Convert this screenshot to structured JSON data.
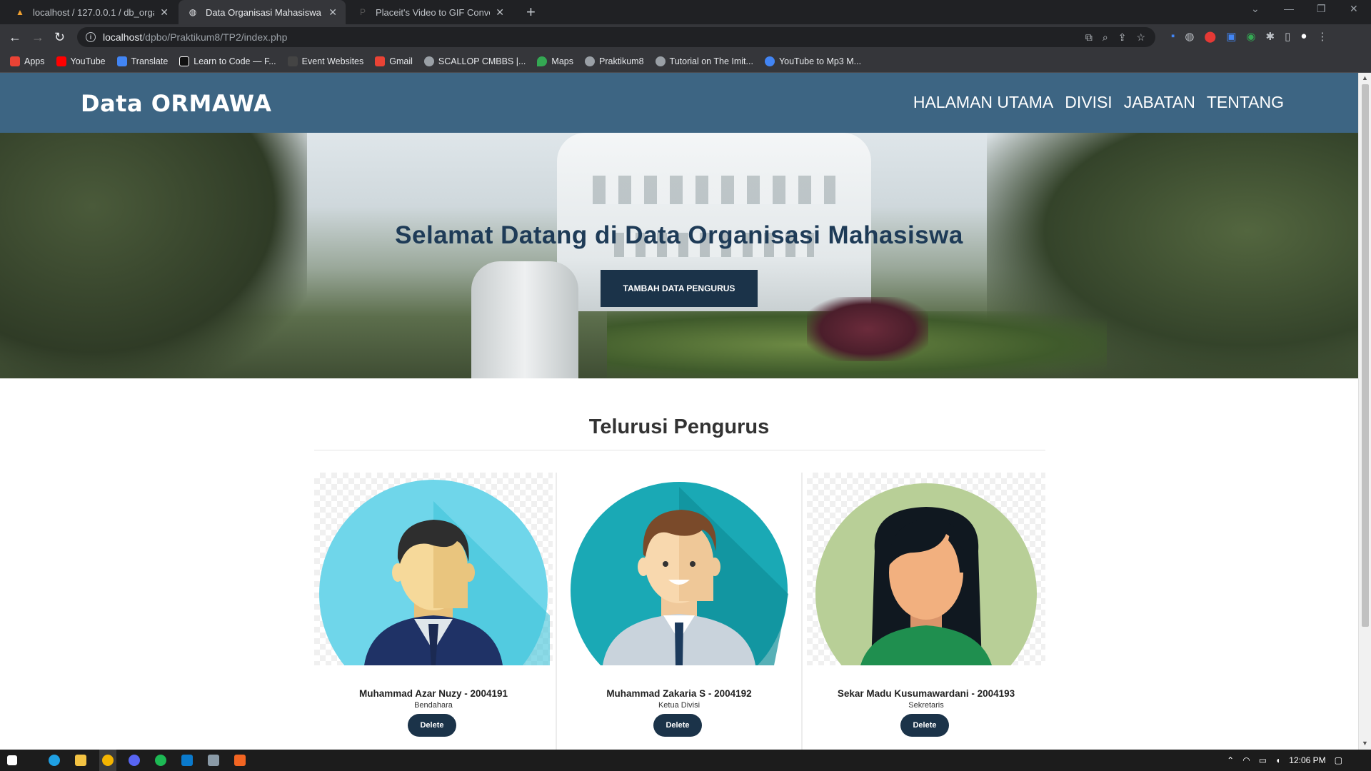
{
  "browser": {
    "tabs": [
      {
        "title": "localhost / 127.0.0.1 / db_organis",
        "active": false
      },
      {
        "title": "Data Organisasi Mahasiswa",
        "active": true
      },
      {
        "title": "Placeit's Video to GIF Converter",
        "active": false
      }
    ],
    "url_host": "localhost",
    "url_path": "/dpbo/Praktikum8/TP2/index.php",
    "bookmarks": [
      {
        "label": "Apps",
        "color": "#ea4335"
      },
      {
        "label": "YouTube",
        "color": "#ff0000"
      },
      {
        "label": "Translate",
        "color": "#4285f4"
      },
      {
        "label": "Learn to Code — F...",
        "color": "#ffffff"
      },
      {
        "label": "Event Websites",
        "color": "#444444"
      },
      {
        "label": "Gmail",
        "color": "#ea4335"
      },
      {
        "label": "SCALLOP CMBBS |...",
        "color": "#9aa0a6"
      },
      {
        "label": "Maps",
        "color": "#34a853"
      },
      {
        "label": "Praktikum8",
        "color": "#9aa0a6"
      },
      {
        "label": "Tutorial on The Imit...",
        "color": "#9aa0a6"
      },
      {
        "label": "YouTube to Mp3 M...",
        "color": "#4285f4"
      }
    ]
  },
  "site": {
    "brand": "Data ORMAWA",
    "nav": [
      "HALAMAN UTAMA",
      "DIVISI",
      "JABATAN",
      "TENTANG"
    ],
    "hero_title": "Selamat Datang di Data Organisasi Mahasiswa",
    "hero_button": "TAMBAH DATA PENGURUS",
    "section_title": "Telurusi Pengurus",
    "cards": [
      {
        "name": "Muhammad Azar Nuzy - 2004191",
        "role": "Bendahara",
        "button": "Delete",
        "bg": "#6fd6ea"
      },
      {
        "name": "Muhammad Zakaria S - 2004192",
        "role": "Ketua Divisi",
        "button": "Delete",
        "bg": "#1aa9b5"
      },
      {
        "name": "Sekar Madu Kusumawardani - 2004193",
        "role": "Sekretaris",
        "button": "Delete",
        "bg": "#b8cf97"
      }
    ]
  },
  "taskbar": {
    "clock": "12:06 PM"
  },
  "colors": {
    "navbar": "#3d6583",
    "button": "#1b3349",
    "hero_title": "#1e3b57"
  }
}
